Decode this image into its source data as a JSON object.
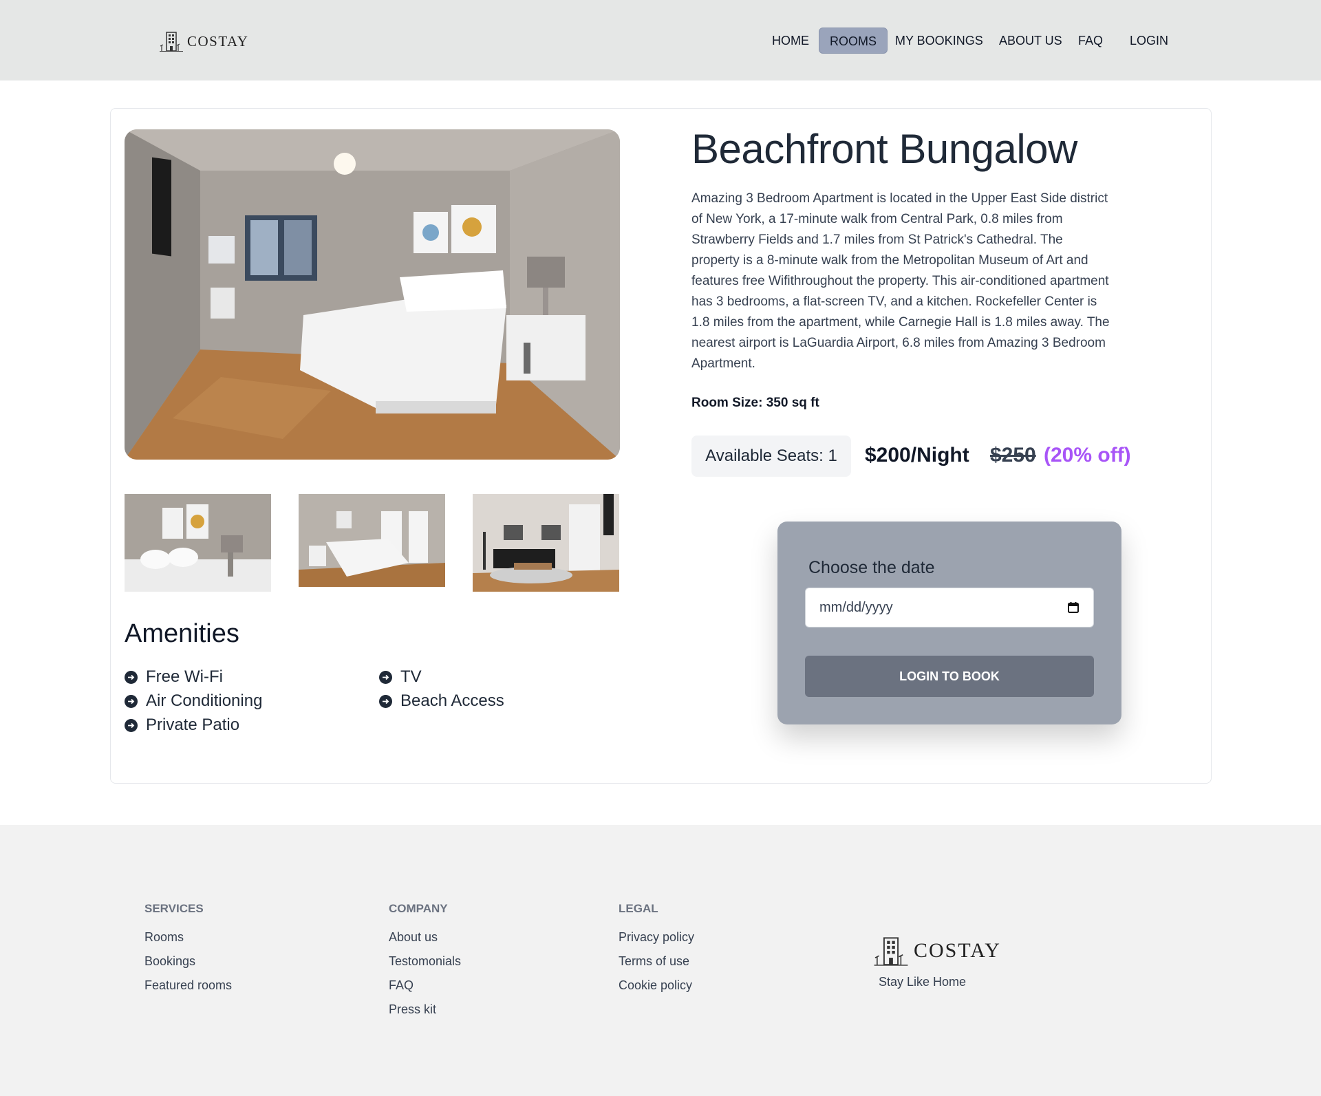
{
  "brand": {
    "name": "COSTAY",
    "tagline": "Stay Like Home"
  },
  "nav": {
    "items": [
      {
        "label": "Home",
        "active": false
      },
      {
        "label": "Rooms",
        "active": true
      },
      {
        "label": "My Bookings",
        "active": false
      },
      {
        "label": "About Us",
        "active": false
      },
      {
        "label": "FAQ",
        "active": false
      },
      {
        "label": "Login",
        "active": false
      }
    ]
  },
  "room": {
    "title": "Beachfront Bungalow",
    "description": "Amazing 3 Bedroom Apartment is located in the Upper East Side district of New York, a 17-minute walk from Central Park, 0.8 miles from Strawberry Fields and 1.7 miles from St Patrick's Cathedral. The property is a 8-minute walk from the Metropolitan Museum of Art and features free Wifithroughout the property. This air-conditioned apartment has 3 bedrooms, a flat-screen TV, and a kitchen. Rockefeller Center is 1.8 miles from the apartment, while Carnegie Hall is 1.8 miles away. The nearest airport is LaGuardia Airport, 6.8 miles from Amazing 3 Bedroom Apartment.",
    "size_label": "Room Size: 350 sq ft",
    "seats_label": "Available Seats: 1",
    "price_label": "$200/Night",
    "old_price_label": "$250",
    "discount_label": "(20% off)",
    "accent_color": "#a855f7"
  },
  "amenities": {
    "title": "Amenities",
    "items": [
      "Free Wi-Fi",
      "Air Conditioning",
      "Private Patio",
      "TV",
      "Beach Access"
    ]
  },
  "booking": {
    "label": "Choose the date",
    "date_placeholder": "mm/dd/yyyy",
    "button_label": "Login to Book"
  },
  "footer": {
    "columns": [
      {
        "heading": "Services",
        "links": [
          "Rooms",
          "Bookings",
          "Featured rooms"
        ]
      },
      {
        "heading": "Company",
        "links": [
          "About us",
          "Testomonials",
          "FAQ",
          "Press kit"
        ]
      },
      {
        "heading": "Legal",
        "links": [
          "Privacy policy",
          "Terms of use",
          "Cookie policy"
        ]
      }
    ]
  },
  "icons": {
    "logo": "hotel-building-icon",
    "amenity_bullet": "arrow-circle-right-icon",
    "calendar": "calendar-icon"
  }
}
